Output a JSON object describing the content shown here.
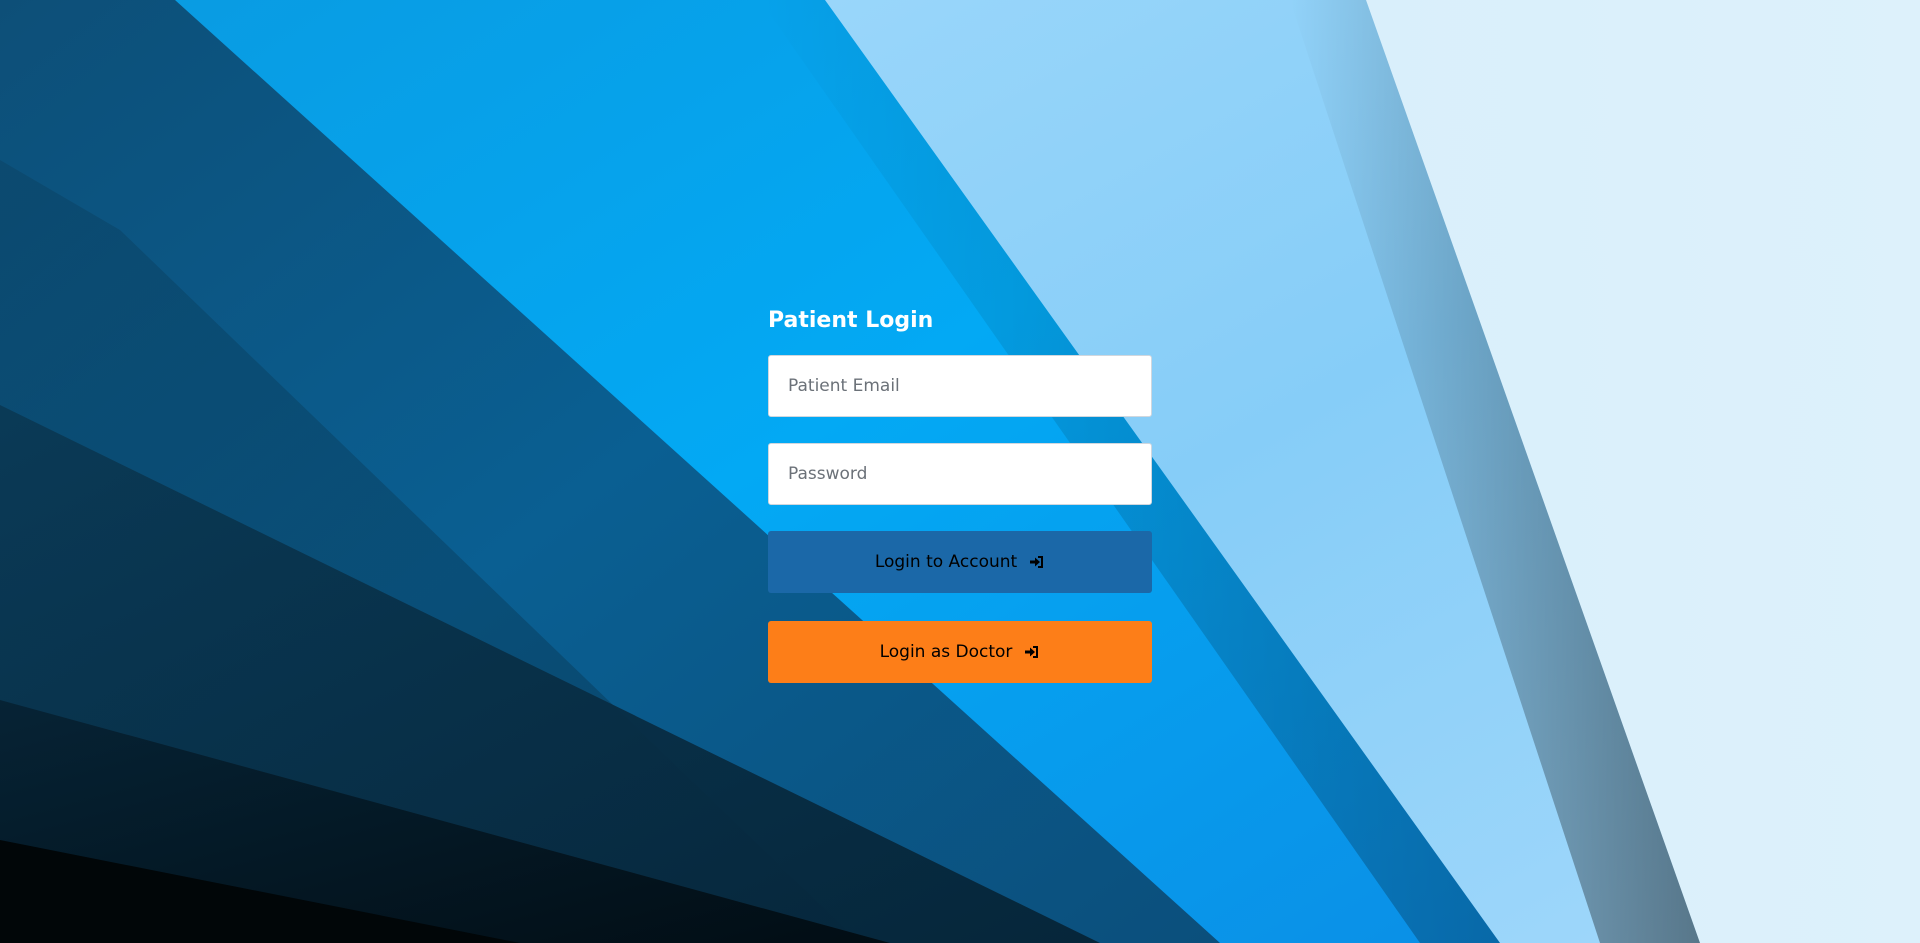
{
  "login": {
    "title": "Patient Login",
    "email_placeholder": "Patient Email",
    "password_placeholder": "Password",
    "account_button_label": "Login to Account",
    "doctor_button_label": "Login as Doctor",
    "account_button_icon": "sign-in-icon",
    "doctor_button_icon": "sign-in-icon"
  },
  "colors": {
    "account_button": "#1b68a8",
    "doctor_button": "#fd7e18",
    "title_text": "#ffffff"
  }
}
